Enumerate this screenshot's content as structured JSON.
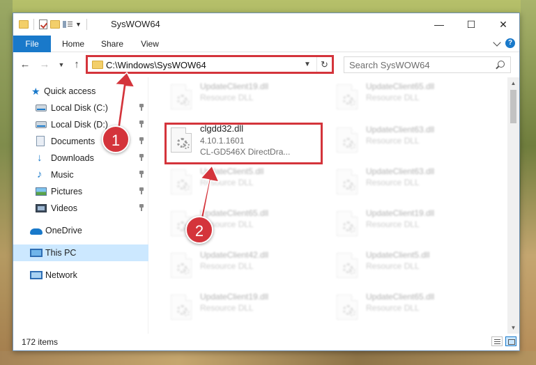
{
  "window": {
    "title": "SysWOW64",
    "controls": [
      "—",
      "☐",
      "✕"
    ]
  },
  "ribbon": {
    "tabs": [
      "File",
      "Home",
      "Share",
      "View"
    ],
    "help": "?"
  },
  "address": {
    "path": "C:\\Windows\\SysWOW64",
    "search_placeholder": "Search SysWOW64"
  },
  "sidebar": {
    "items": [
      {
        "label": "Quick access",
        "icon": "star-icon",
        "pinned": false
      },
      {
        "label": "Local Disk (C:)",
        "icon": "drive-icon",
        "pinned": true
      },
      {
        "label": "Local Disk (D:)",
        "icon": "drive-icon",
        "pinned": true
      },
      {
        "label": "Documents",
        "icon": "documents-icon",
        "pinned": true
      },
      {
        "label": "Downloads",
        "icon": "download-icon",
        "pinned": true
      },
      {
        "label": "Music",
        "icon": "music-icon",
        "pinned": true
      },
      {
        "label": "Pictures",
        "icon": "pictures-icon",
        "pinned": true
      },
      {
        "label": "Videos",
        "icon": "videos-icon",
        "pinned": true
      },
      {
        "label": "OneDrive",
        "icon": "onedrive-icon",
        "pinned": false
      },
      {
        "label": "This PC",
        "icon": "computer-icon",
        "pinned": false,
        "selected": true
      },
      {
        "label": "Network",
        "icon": "network-icon",
        "pinned": false
      }
    ]
  },
  "files": {
    "highlighted": {
      "name": "clgdd32.dll",
      "version": "4.10.1.1601",
      "description": "CL-GD546X DirectDra..."
    },
    "left_column": [
      {
        "name": "UpdateClient19.dll",
        "type": "Resource DLL"
      },
      {
        "name": "UpdateClient5.dll",
        "type": "Resource DLL"
      },
      {
        "name": "UpdateClient65.dll",
        "type": "Resource DLL"
      },
      {
        "name": "UpdateClient42.dll",
        "type": "Resource DLL"
      },
      {
        "name": "UpdateClient19.dll",
        "type": "Resource DLL"
      }
    ],
    "right_column": [
      {
        "name": "UpdateClient65.dll",
        "type": "Resource DLL"
      },
      {
        "name": "UpdateClient63.dll",
        "type": "Resource DLL"
      },
      {
        "name": "UpdateClient63.dll",
        "type": "Resource DLL"
      },
      {
        "name": "UpdateClient19.dll",
        "type": "Resource DLL"
      },
      {
        "name": "UpdateClient5.dll",
        "type": "Resource DLL"
      },
      {
        "name": "UpdateClient65.dll",
        "type": "Resource DLL"
      }
    ]
  },
  "status": {
    "item_count": "172 items"
  },
  "annotations": {
    "step1": "1",
    "step2": "2",
    "color": "#d4343b"
  }
}
